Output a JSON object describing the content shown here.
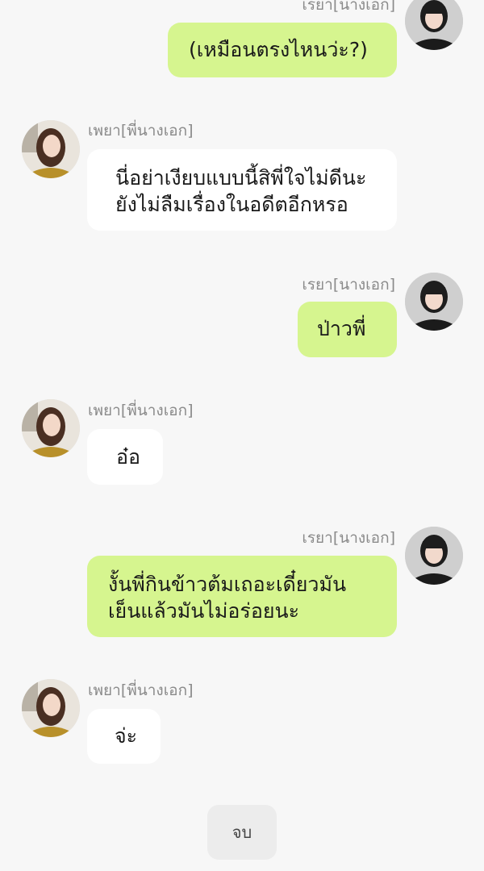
{
  "messages": [
    {
      "side": "right",
      "name": "เรยา[นางเอก]",
      "lines": [
        "(เหมือนตรงไหนว่ะ?)"
      ]
    },
    {
      "side": "left",
      "name": "เพยา[พี่นางเอก]",
      "lines": [
        "นี่อย่าเงียบแบบนี้สิพี่ใจไม่ดีนะ",
        "ยังไม่ลืมเรื่องในอดีตอีกหรอ"
      ]
    },
    {
      "side": "right",
      "name": "เรยา[นางเอก]",
      "lines": [
        "ป่าวพี่"
      ]
    },
    {
      "side": "left",
      "name": "เพยา[พี่นางเอก]",
      "lines": [
        "อ๋อ"
      ]
    },
    {
      "side": "right",
      "name": "เรยา[นางเอก]",
      "lines": [
        "งั้นพี่กินข้าวต้มเถอะเดี๋ยวมัน",
        "เย็นแล้วมันไม่อร่อยนะ"
      ]
    },
    {
      "side": "left",
      "name": "เพยา[พี่นางเอก]",
      "lines": [
        "จ่ะ"
      ]
    }
  ],
  "end_button": {
    "label": "จบ"
  },
  "colors": {
    "right_bubble": "#d6f58f",
    "left_bubble": "#ffffff",
    "background": "#f7f7f7"
  }
}
